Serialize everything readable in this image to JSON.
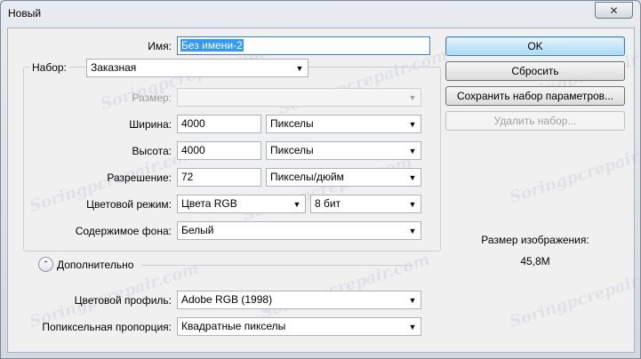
{
  "window": {
    "title": "Новый",
    "close_symbol": "✕"
  },
  "name": {
    "label": "Имя:",
    "value": "Без имени-2"
  },
  "preset": {
    "label": "Набор:",
    "value": "Заказная",
    "size_label": "Размер:",
    "size_value": "",
    "width": {
      "label": "Ширина:",
      "value": "4000",
      "unit": "Пикселы"
    },
    "height": {
      "label": "Высота:",
      "value": "4000",
      "unit": "Пикселы"
    },
    "resolution": {
      "label": "Разрешение:",
      "value": "72",
      "unit": "Пикселы/дюйм"
    },
    "color_mode": {
      "label": "Цветовой режим:",
      "value": "Цвета RGB",
      "depth": "8 бит"
    },
    "background": {
      "label": "Содержимое фона:",
      "value": "Белый"
    }
  },
  "advanced": {
    "label": "Дополнительно",
    "color_profile": {
      "label": "Цветовой профиль:",
      "value": "Adobe RGB (1998)"
    },
    "pixel_aspect": {
      "label": "Попиксельная пропорция:",
      "value": "Квадратные пикселы"
    }
  },
  "buttons": {
    "ok": "OK",
    "reset": "Сбросить",
    "save_preset": "Сохранить набор параметров...",
    "delete_preset": "Удалить набор..."
  },
  "image_size": {
    "label": "Размер изображения:",
    "value": "45,8M"
  },
  "watermark_text": "Soringpcrepair.com",
  "icons": {
    "dropdown": "chevron-down-icon",
    "expander": "chevron-up-double-icon"
  }
}
